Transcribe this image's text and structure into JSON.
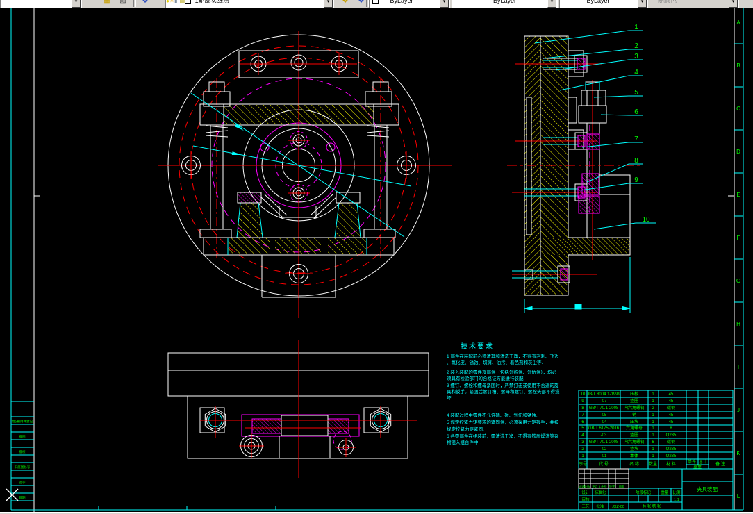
{
  "toolbar": {
    "workspace_value": "",
    "layer_value": "1轮廓实线层",
    "color_value": "ByLayer",
    "linetype_value": "ByLayer",
    "lineweight_value": "ByLayer",
    "plotstyle_value": "随颜色"
  },
  "frame": {
    "zones": [
      "A",
      "B",
      "C",
      "D",
      "E",
      "F",
      "G",
      "H",
      "I",
      "J",
      "K",
      "L"
    ],
    "margin_cells": [
      "借(通)用件登记",
      "描图",
      "描校",
      "旧底图总号",
      "签字",
      "日期"
    ]
  },
  "section_view": {
    "callouts": [
      "1",
      "2",
      "3",
      "4",
      "5",
      "6",
      "7",
      "8",
      "9",
      "10"
    ]
  },
  "tech_requirements": {
    "title": "技术要求",
    "lines": [
      "1 部件在装配前必须清理和清洗干净，不得有毛刺、飞边",
      "、氧化皮、锈蚀、切屑、油污、着色剂和灰尘等.",
      "2 装入装配的零件及部件（包括外购件、外协件），均必",
      "须具有检验部门的合格证方能进行装配.",
      "3 螺钉、螺栓和螺母紧固时，严禁打击或使用不合适的旋",
      "具和扳手。紧固后螺钉槽、螺母和螺钉、螺栓头部不得损",
      "坏.",
      "4 装配过程中零件不允许磕、碰、划伤和锈蚀.",
      "5 规定拧紧力矩要求的紧固件，必须采用力矩扳手，并按",
      "规定拧紧力矩紧固.",
      "6 各零部件在组装前，需清洗干净，不得有铁屑焊渣等杂",
      "物混入组合件中"
    ]
  },
  "bom": {
    "headers": {
      "no": "序号",
      "code": "代  号",
      "name": "名  称",
      "qty": "数量",
      "material": "材  料",
      "unit": "单件",
      "total": "总计",
      "weight": "重量",
      "remark": "备  注"
    },
    "rows": [
      {
        "no": "10",
        "code": "JB/T 8004.1-1999",
        "name": "压板",
        "qty": "1",
        "material": "45"
      },
      {
        "no": "9",
        "code": "-07",
        "name": "垫圈",
        "qty": "1",
        "material": "45"
      },
      {
        "no": "8",
        "code": "GB/T 70.1-2008",
        "name": "内六角螺钉",
        "qty": "2",
        "material": "碳钢"
      },
      {
        "no": "7",
        "code": "-05",
        "name": "销",
        "qty": "1",
        "material": "45"
      },
      {
        "no": "6",
        "code": "-04",
        "name": "压块",
        "qty": "1",
        "material": "45"
      },
      {
        "no": "5",
        "code": "GB/T 6175-2016",
        "name": "六角螺母",
        "qty": "1",
        "material": "8"
      },
      {
        "no": "4",
        "code": "-03",
        "name": "垫圈",
        "qty": "1",
        "material": "Q235"
      },
      {
        "no": "3",
        "code": "GB/T 70.1-2008",
        "name": "内六角螺钉",
        "qty": "6",
        "material": "碳钢"
      },
      {
        "no": "2",
        "code": "-02",
        "name": "垫块",
        "qty": "1",
        "material": "Q235"
      },
      {
        "no": "1",
        "code": "-01",
        "name": "本体",
        "qty": "1",
        "material": "Q235"
      }
    ]
  },
  "title_block": {
    "revision_header": {
      "mark": "标记",
      "count": "处数",
      "doc": "更改文件号",
      "sign": "签字",
      "date": "日期"
    },
    "design_label": "设计",
    "standard_label": "标准化",
    "check_label": "审核",
    "process_label": "工艺",
    "approve_label": "批准",
    "stage_label": "阶段标记",
    "weight_label": "重量",
    "scale_label": "比例",
    "scale_value": "1:1",
    "sheet_info": "共 张 第 张",
    "drawing_code": "JXZ-00",
    "drawing_title": "夹具装配"
  }
}
